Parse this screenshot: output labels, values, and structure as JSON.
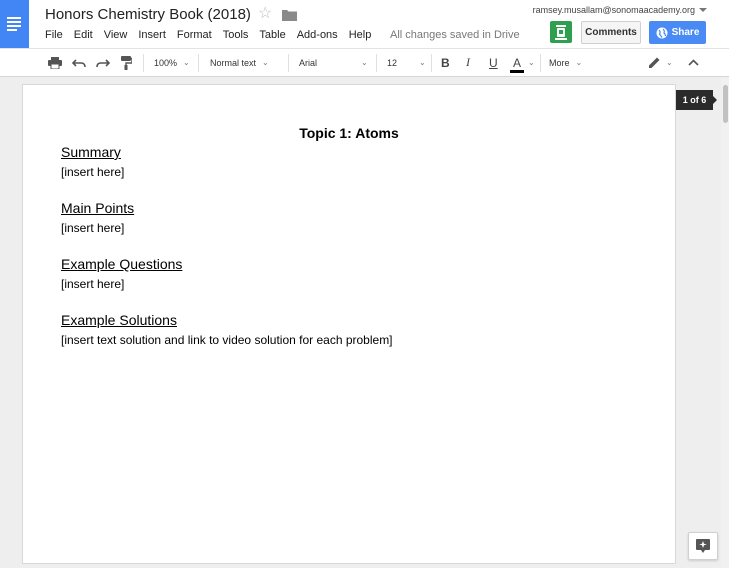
{
  "document": {
    "title": "Honors Chemistry Book (2018)",
    "save_status": "All changes saved in Drive",
    "heading": "Topic 1: Atoms",
    "sections": [
      {
        "heading": "Summary",
        "body": "[insert here]"
      },
      {
        "heading": "Main Points",
        "body": "[insert here]"
      },
      {
        "heading": "Example Questions",
        "body": "[insert here]"
      },
      {
        "heading": "Example Solutions",
        "body": "[insert text solution and link to video solution for each problem]"
      }
    ],
    "page_indicator": "1 of 6"
  },
  "menu": [
    "File",
    "Edit",
    "View",
    "Insert",
    "Format",
    "Tools",
    "Table",
    "Add-ons",
    "Help"
  ],
  "account": {
    "email": "ramsey.musallam@sonomaacademy.org"
  },
  "buttons": {
    "comments": "Comments",
    "share": "Share"
  },
  "toolbar": {
    "zoom": "100%",
    "style": "Normal text",
    "font": "Arial",
    "font_size": "12",
    "more": "More",
    "bold": "B",
    "italic": "I",
    "underline": "U",
    "text_color": "A"
  },
  "colors": {
    "brand": "#4285f4",
    "share": "#4a8af4",
    "avatar": "#2e9e4f"
  }
}
